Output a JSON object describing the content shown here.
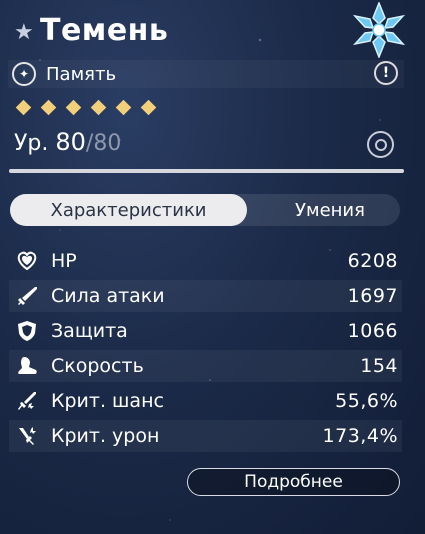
{
  "header": {
    "name": "Темень"
  },
  "role": {
    "label": "Память"
  },
  "rarity": {
    "stars": 6
  },
  "level": {
    "prefix": "Ур.",
    "current": "80",
    "max": "/80",
    "progress": 1.0
  },
  "tabs": [
    {
      "label": "Характеристики"
    },
    {
      "label": "Умения"
    }
  ],
  "stats": [
    {
      "label": "HP",
      "value": "6208",
      "icon": "heart-icon"
    },
    {
      "label": "Сила атаки",
      "value": "1697",
      "icon": "sword-icon"
    },
    {
      "label": "Защита",
      "value": "1066",
      "icon": "shield-icon"
    },
    {
      "label": "Скорость",
      "value": "154",
      "icon": "boot-icon"
    },
    {
      "label": "Крит. шанс",
      "value": "55,6%",
      "icon": "crit-rate-icon"
    },
    {
      "label": "Крит. урон",
      "value": "173,4%",
      "icon": "crit-damage-icon"
    }
  ],
  "details_button": {
    "label": "Подробнее"
  },
  "colors": {
    "accent_gold": "#f2cf7a",
    "tab_active_bg": "#ececee",
    "element_ice": "#6ec8f4"
  }
}
